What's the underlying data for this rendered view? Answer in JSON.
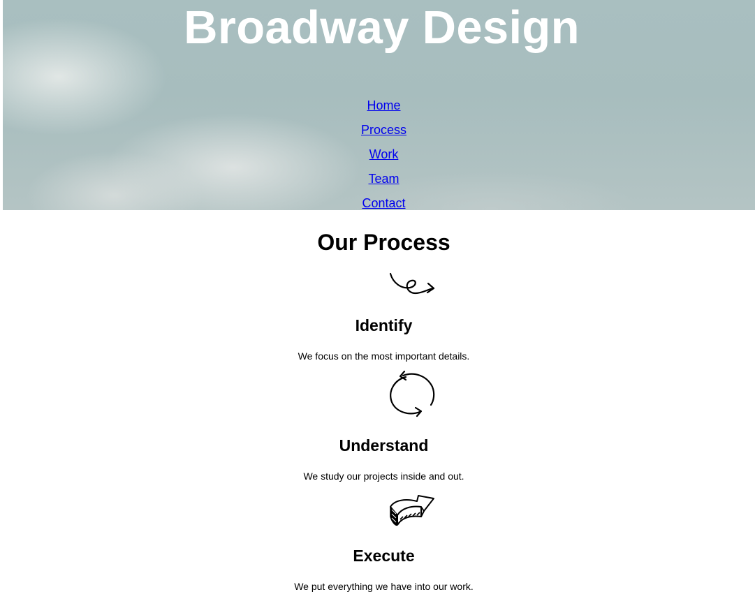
{
  "header": {
    "site_title": "Broadway Design"
  },
  "nav": {
    "items": [
      {
        "label": "Home"
      },
      {
        "label": "Process"
      },
      {
        "label": "Work"
      },
      {
        "label": "Team"
      },
      {
        "label": "Contact"
      }
    ]
  },
  "process": {
    "title": "Our Process",
    "steps": [
      {
        "title": "Identify",
        "description": "We focus on the most important details.",
        "icon": "curly-arrow-icon"
      },
      {
        "title": "Understand",
        "description": "We study our projects inside and out.",
        "icon": "cycle-arrows-icon"
      },
      {
        "title": "Execute",
        "description": "We put everything we have into our work.",
        "icon": "bold-arrow-icon"
      }
    ]
  },
  "colors": {
    "link": "#0000ee",
    "hero_sky": "#a9bfc0",
    "title_text": "#ffffff"
  }
}
